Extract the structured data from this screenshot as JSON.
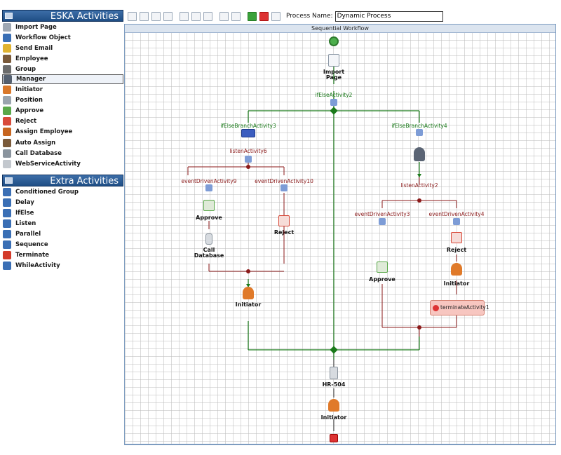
{
  "sidebar": {
    "section1": {
      "title": "ESKA Activities",
      "items": [
        {
          "label": "Import Page",
          "icon": "page-icon",
          "color": "#9fa8b3"
        },
        {
          "label": "Workflow Object",
          "icon": "workflow-object-icon",
          "color": "#3a6fb5"
        },
        {
          "label": "Send Email",
          "icon": "email-icon",
          "color": "#e0b330"
        },
        {
          "label": "Employee",
          "icon": "employee-icon",
          "color": "#7a5a3a"
        },
        {
          "label": "Group",
          "icon": "group-icon",
          "color": "#6b6b6b"
        },
        {
          "label": "Manager",
          "icon": "manager-icon",
          "color": "#556070"
        },
        {
          "label": "Initiator",
          "icon": "initiator-icon",
          "color": "#d9782a"
        },
        {
          "label": "Position",
          "icon": "position-icon",
          "color": "#9aa4ae"
        },
        {
          "label": "Approve",
          "icon": "approve-icon",
          "color": "#5aa84a"
        },
        {
          "label": "Reject",
          "icon": "reject-icon",
          "color": "#d84a3a"
        },
        {
          "label": "Assign Employee",
          "icon": "assign-employee-icon",
          "color": "#c7651f"
        },
        {
          "label": "Auto Assign",
          "icon": "auto-assign-icon",
          "color": "#7a5a3a"
        },
        {
          "label": "Call Database",
          "icon": "database-icon",
          "color": "#8a949e"
        },
        {
          "label": "WebServiceActivity",
          "icon": "webservice-icon",
          "color": "#c3c8ce"
        }
      ],
      "selected_index": 5
    },
    "section2": {
      "title": "Extra Activities",
      "items": [
        {
          "label": "Conditioned Group",
          "icon": "conditioned-group-icon",
          "color": "#3a6fb5"
        },
        {
          "label": "Delay",
          "icon": "delay-icon",
          "color": "#3a6fb5"
        },
        {
          "label": "IfElse",
          "icon": "ifelse-icon",
          "color": "#3a6fb5"
        },
        {
          "label": "Listen",
          "icon": "listen-icon",
          "color": "#3a6fb5"
        },
        {
          "label": "Parallel",
          "icon": "parallel-icon",
          "color": "#3a6fb5"
        },
        {
          "label": "Sequence",
          "icon": "sequence-icon",
          "color": "#3a6fb5"
        },
        {
          "label": "Terminate",
          "icon": "terminate-icon",
          "color": "#d33b2a"
        },
        {
          "label": "WhileActivity",
          "icon": "while-icon",
          "color": "#3a6fb5"
        }
      ]
    }
  },
  "toolbar": {
    "process_name_label": "Process Name:",
    "process_name_value": "Dynamic Process"
  },
  "canvas": {
    "header": "Sequential Workflow",
    "labels": {
      "import_page": "Import Page",
      "ifelse2": "ifElseActivity2",
      "branch3": "ifElseBranchActivity3",
      "branch4": "ifElseBranchActivity4",
      "listen6": "listenActivity6",
      "listen2": "listenActivity2",
      "ev9": "eventDrivenActivity9",
      "ev10": "eventDrivenActivity10",
      "ev3": "eventDrivenActivity3",
      "ev4": "eventDrivenActivity4",
      "approve_left": "Approve",
      "reject_left": "Reject",
      "call_database": "Call Database",
      "initiator_left": "Initiator",
      "approve_right": "Approve",
      "reject_right": "Reject",
      "initiator_right": "Initiator",
      "terminate": "terminateActivity1",
      "hr504": "HR-504",
      "initiator_bottom": "Initiator"
    }
  }
}
